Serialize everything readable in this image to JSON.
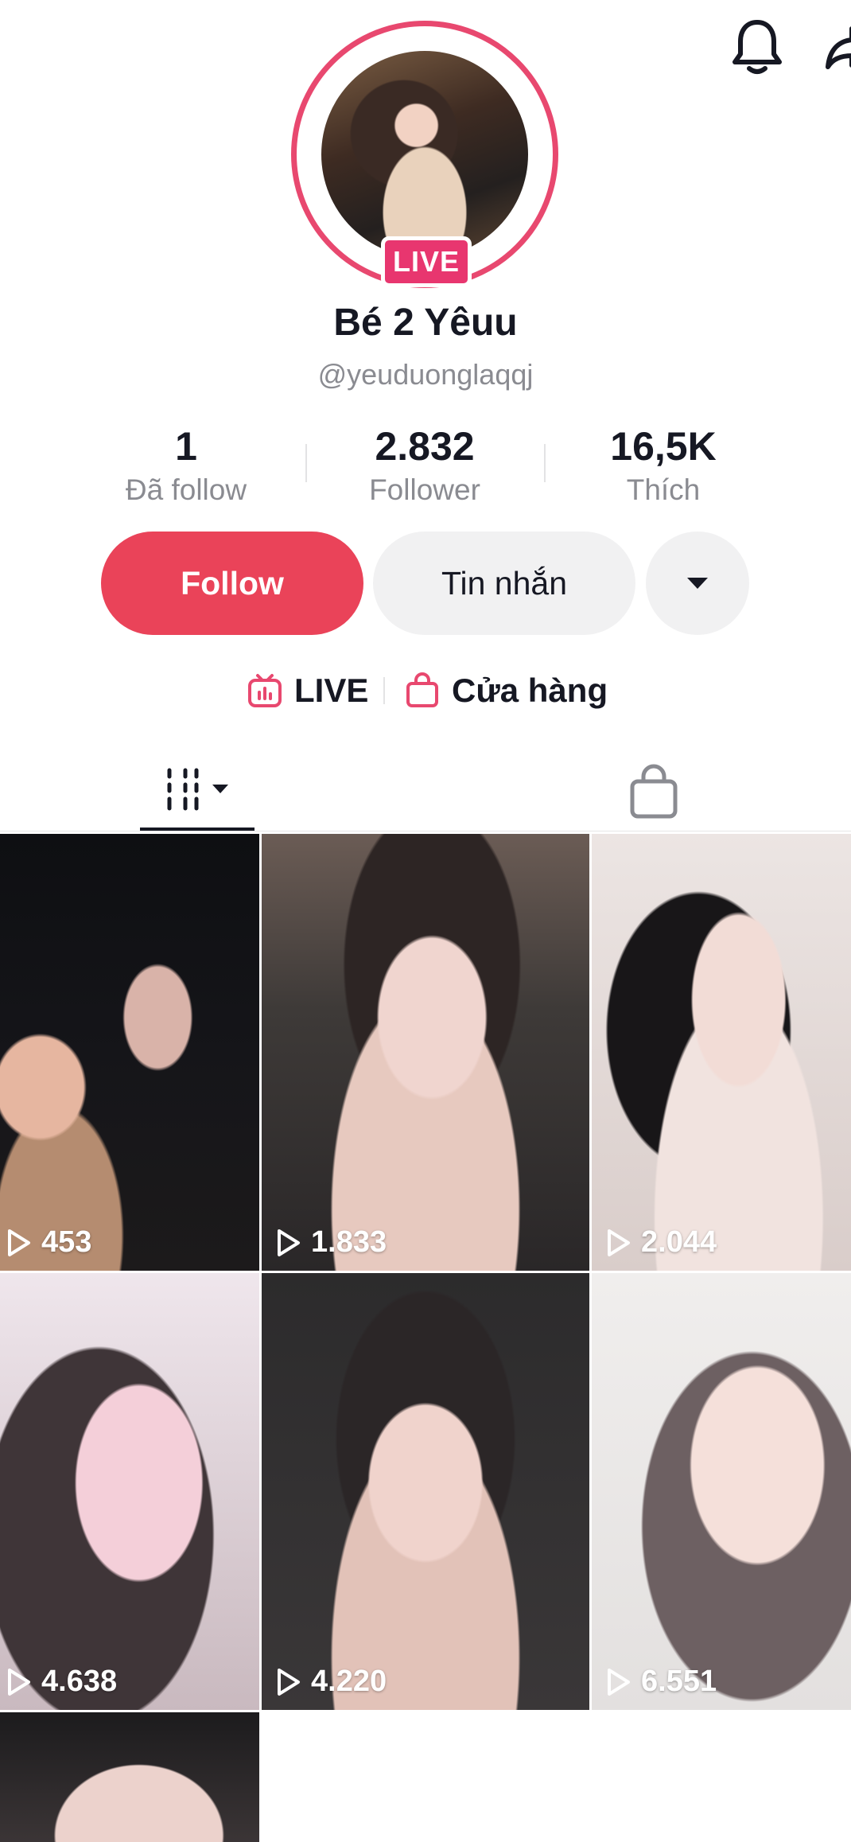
{
  "header": {
    "icons": [
      "bell-icon",
      "share-icon"
    ]
  },
  "profile": {
    "live_badge": "LIVE",
    "display_name": "Bé 2 Yêuu",
    "username": "@yeuduonglaqqj"
  },
  "stats": [
    {
      "value": "1",
      "label": "Đã follow"
    },
    {
      "value": "2.832",
      "label": "Follower"
    },
    {
      "value": "16,5K",
      "label": "Thích"
    }
  ],
  "actions": {
    "follow_label": "Follow",
    "message_label": "Tin nhắn"
  },
  "links": {
    "live_label": "LIVE",
    "shop_label": "Cửa hàng"
  },
  "colors": {
    "accent": "#ea4359",
    "live_pink": "#e8366f"
  },
  "videos": [
    {
      "views": "453"
    },
    {
      "views": "1.833"
    },
    {
      "views": "2.044"
    },
    {
      "views": "4.638"
    },
    {
      "views": "4.220"
    },
    {
      "views": "6.551"
    },
    {
      "views": ""
    }
  ]
}
